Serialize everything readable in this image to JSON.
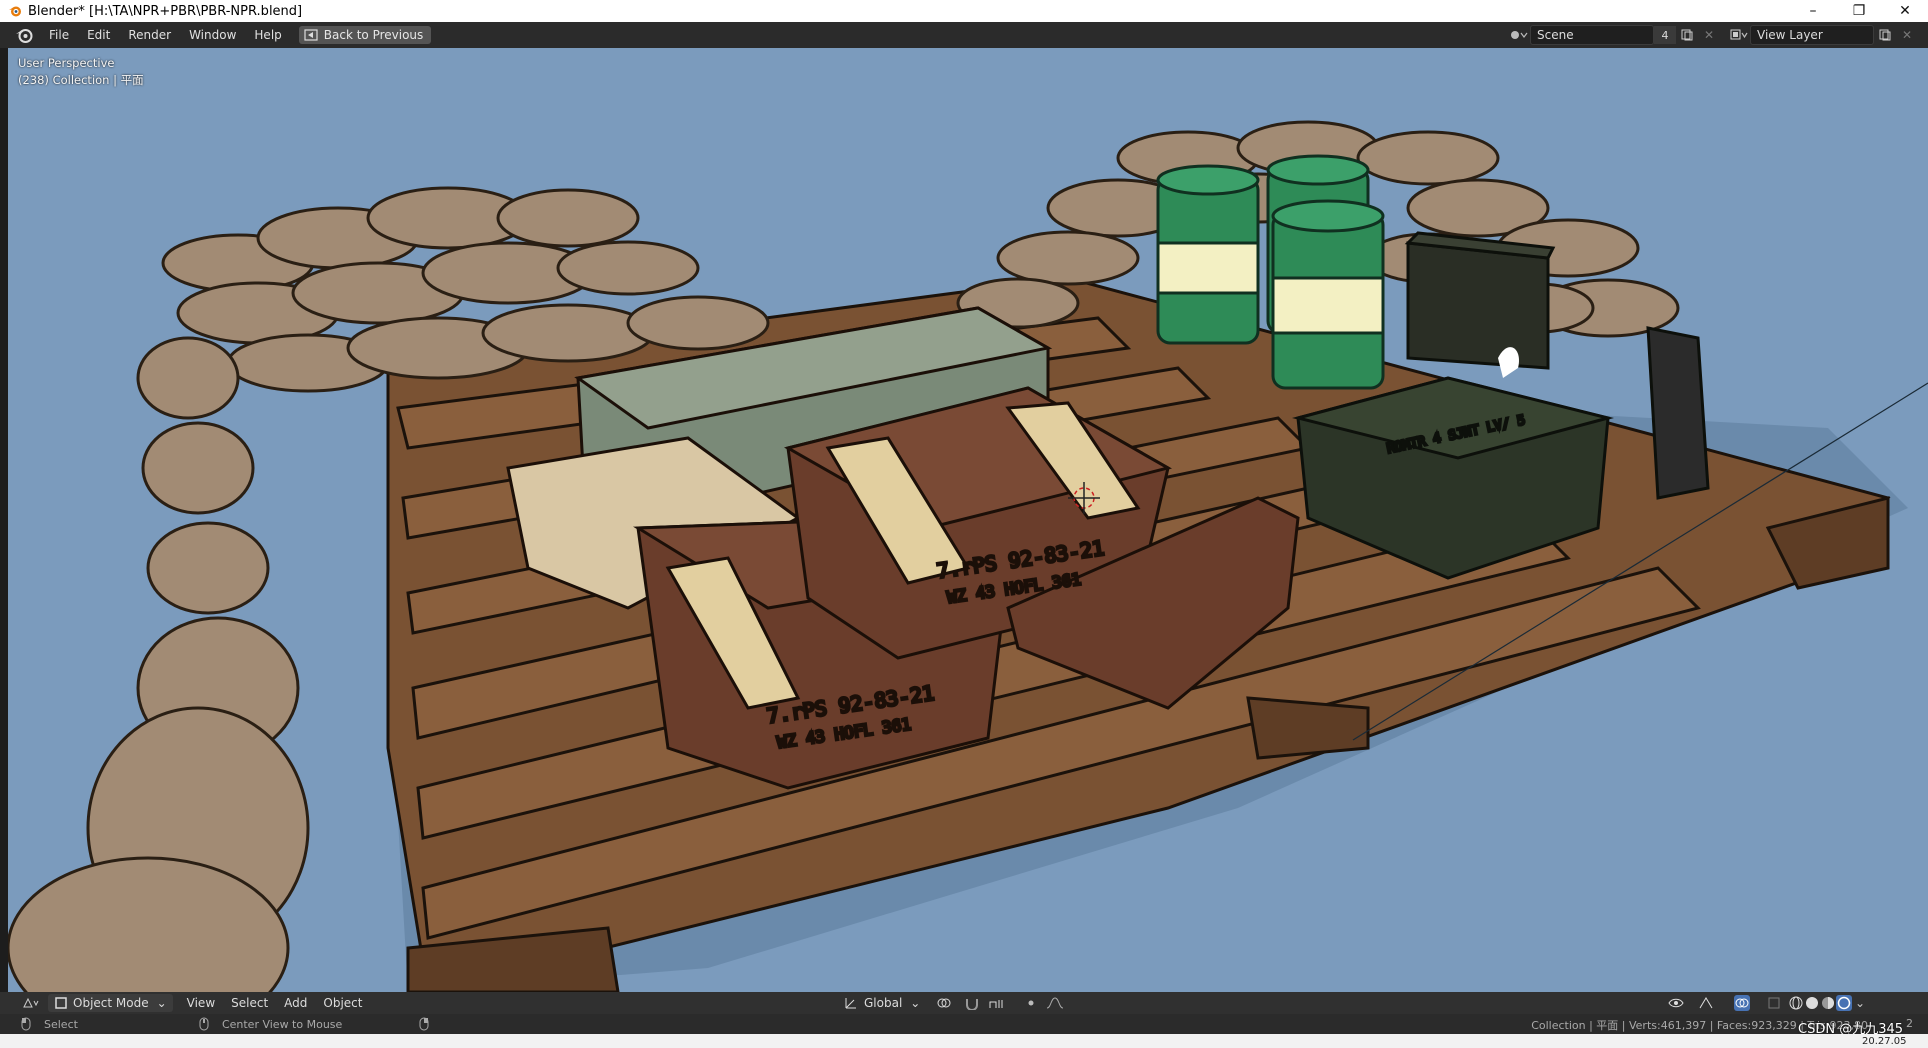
{
  "window": {
    "title": "Blender* [H:\\TA\\NPR+PBR\\PBR-NPR.blend]",
    "controls": [
      "–",
      "❐",
      "✕"
    ]
  },
  "menubar": {
    "items": [
      "File",
      "Edit",
      "Render",
      "Window",
      "Help"
    ],
    "back_button": "Back to Previous",
    "scene_label": "Scene",
    "scene_users": "4",
    "view_layer_label": "View Layer"
  },
  "viewport": {
    "perspective_label": "User Perspective",
    "collection_label": "(238) Collection | 平面",
    "background_color": "#7b9bbd"
  },
  "viewport_header": {
    "mode": "Object Mode",
    "menus": [
      "View",
      "Select",
      "Add",
      "Object"
    ],
    "orientation": "Global"
  },
  "statusbar": {
    "left_action": "Select",
    "middle_action": "Center View to Mouse",
    "stats": "Collection | 平面 | Verts:461,397 | Faces:923,329 | Tris:923,80",
    "stats_tail": "2"
  },
  "overlay": {
    "watermark": "CSDN @九九345",
    "clock_fragment": "20.27.05"
  },
  "colors": {
    "accent": "#4772b3",
    "header_bg": "#2b2b2b",
    "wood": "#7a5233",
    "sandbag": "#a28b74",
    "barrel_green": "#2e8b57",
    "barrel_cream": "#f3f0c3",
    "dark_crate": "#2c3527"
  }
}
